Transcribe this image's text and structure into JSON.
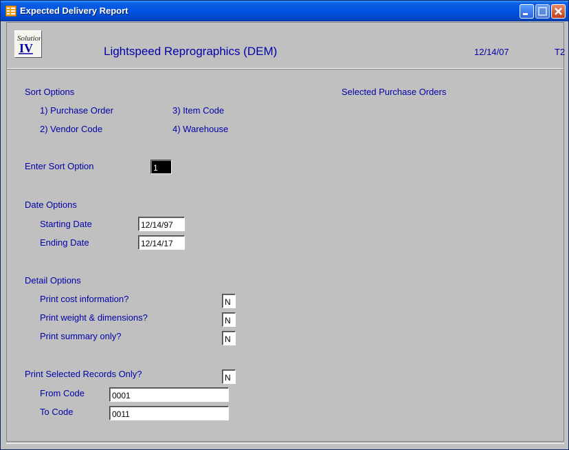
{
  "window": {
    "title": "Expected Delivery Report"
  },
  "header": {
    "company": "Lightspeed Reprographics (DEM)",
    "date": "12/14/07",
    "terminal": "T2"
  },
  "sort_options": {
    "title": "Sort Options",
    "items": [
      "1) Purchase Order",
      "3) Item Code",
      "2) Vendor Code",
      "4) Warehouse"
    ]
  },
  "selected_orders_label": "Selected Purchase Orders",
  "enter_sort": {
    "label": "Enter Sort Option",
    "value": "1"
  },
  "date_options": {
    "title": "Date Options",
    "starting_label": "Starting Date",
    "starting_value": "12/14/97",
    "ending_label": "Ending Date",
    "ending_value": "12/14/17"
  },
  "detail_options": {
    "title": "Detail Options",
    "cost_label": "Print cost information?",
    "cost_value": "N",
    "weight_label": "Print weight & dimensions?",
    "weight_value": "N",
    "summary_label": "Print summary only?",
    "summary_value": "N"
  },
  "selected_records": {
    "label": "Print Selected Records Only?",
    "value": "N",
    "from_label": "From Code",
    "from_value": "0001",
    "to_label": "To Code",
    "to_value": "0011"
  }
}
